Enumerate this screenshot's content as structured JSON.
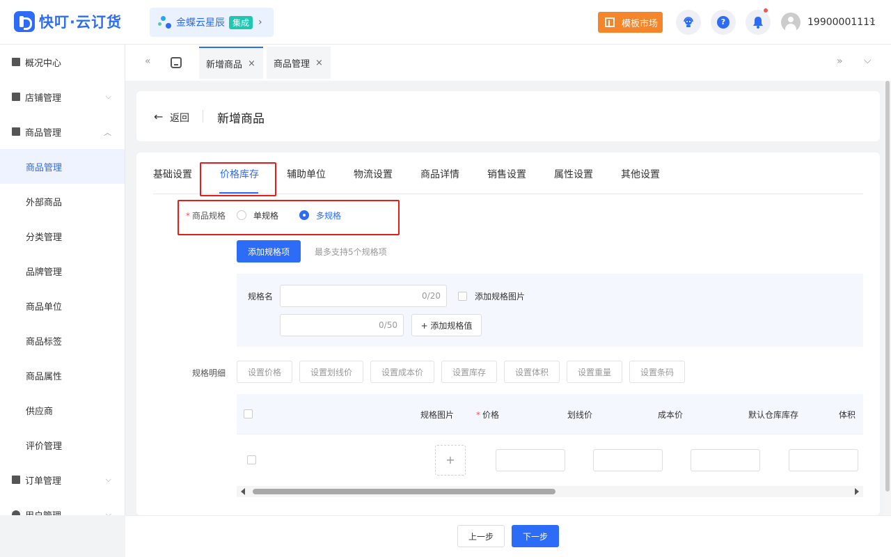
{
  "header": {
    "logo_text": "快叮·云订货",
    "integration": {
      "name": "金蝶云星辰",
      "badge": "集成",
      "arrow": "›"
    },
    "market_button": "模板市场",
    "username": "19900001111",
    "user_caret": "⌵"
  },
  "sidebar": {
    "groups": [
      {
        "label": "概况中心"
      },
      {
        "label": "店铺管理",
        "caret": "⌵"
      },
      {
        "label": "商品管理",
        "caret": "︿"
      },
      {
        "label": "订单管理",
        "caret": "⌵"
      },
      {
        "label": "用户管理",
        "caret": "⌵"
      }
    ],
    "items": [
      {
        "label": "商品管理",
        "active": true
      },
      {
        "label": "外部商品"
      },
      {
        "label": "分类管理"
      },
      {
        "label": "品牌管理"
      },
      {
        "label": "商品单位"
      },
      {
        "label": "商品标签"
      },
      {
        "label": "商品属性"
      },
      {
        "label": "供应商"
      },
      {
        "label": "评价管理"
      }
    ]
  },
  "tabs_bar": {
    "collapse_left": "«",
    "collapse_right": "»",
    "dropdown": "⌵",
    "tabs": [
      {
        "label": "新增商品",
        "close": "×",
        "active": true
      },
      {
        "label": "商品管理",
        "close": "×"
      }
    ]
  },
  "page": {
    "back_arrow": "←",
    "back_label": "返回",
    "title": "新增商品"
  },
  "steps": [
    "基础设置",
    "价格库存",
    "辅助单位",
    "物流设置",
    "商品详情",
    "销售设置",
    "属性设置",
    "其他设置"
  ],
  "spec_type": {
    "required_mark": "*",
    "label": "商品规格",
    "options": [
      "单规格",
      "多规格"
    ],
    "selected": "多规格"
  },
  "add_spec": {
    "button": "添加规格项",
    "hint": "最多支持5个规格项"
  },
  "spec_editor": {
    "name_label": "规格名",
    "name_counter": "0/20",
    "image_checkbox_label": "添加规格图片",
    "value_counter": "0/50",
    "add_value_button": "+ 添加规格值"
  },
  "spec_detail": {
    "label": "规格明细",
    "bulk_buttons": [
      "设置价格",
      "设置划线价",
      "设置成本价",
      "设置库存",
      "设置体积",
      "设置重量",
      "设置条码"
    ]
  },
  "table": {
    "headers": {
      "image": "规格图片",
      "price_required": "*",
      "price": "价格",
      "list_price": "划线价",
      "cost": "成本价",
      "stock": "默认仓库库存",
      "volume": "体积"
    },
    "upload_plus": "+"
  },
  "footer": {
    "prev": "上一步",
    "next": "下一步"
  },
  "colors": {
    "primary": "#2d6cf6",
    "highlight_box": "#e51c1c",
    "market": "#f5852b"
  }
}
